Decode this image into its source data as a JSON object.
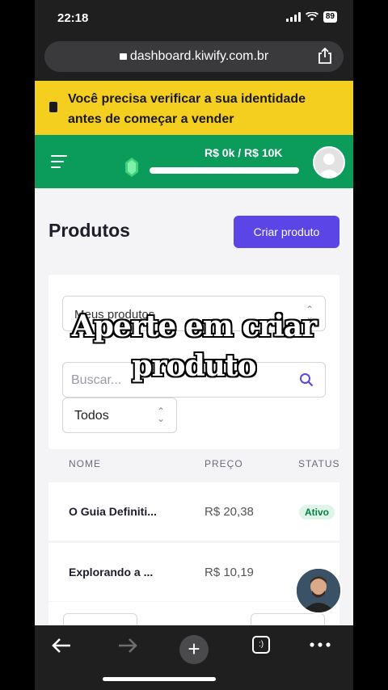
{
  "status_bar": {
    "time": "22:18",
    "battery": "89"
  },
  "browser": {
    "url": "dashboard.kiwify.com.br"
  },
  "banner": {
    "text": "Você precisa verificar a sua identidade antes de começar a vender"
  },
  "header": {
    "goal_text": "R$ 0k / R$ 10K",
    "goal_progress": 0.0
  },
  "page": {
    "title": "Produtos",
    "create_button": "Criar produto"
  },
  "filters": {
    "product_select": "Meus produtos",
    "search_placeholder": "Buscar...",
    "status_select": "Todos"
  },
  "table": {
    "columns": [
      "NOME",
      "PREÇO",
      "STATUS"
    ],
    "rows": [
      {
        "name": "O Guia Definiti...",
        "price": "R$ 20,38",
        "status": "Ativo"
      },
      {
        "name": "Explorando a ...",
        "price": "R$ 10,19",
        "status": ""
      }
    ]
  },
  "overlay": {
    "line1": "Aperte em criar",
    "line2": "produto"
  },
  "colors": {
    "brand_green": "#0b9b5b",
    "accent_purple": "#5b45e6",
    "banner_yellow": "#f5cf1f"
  }
}
